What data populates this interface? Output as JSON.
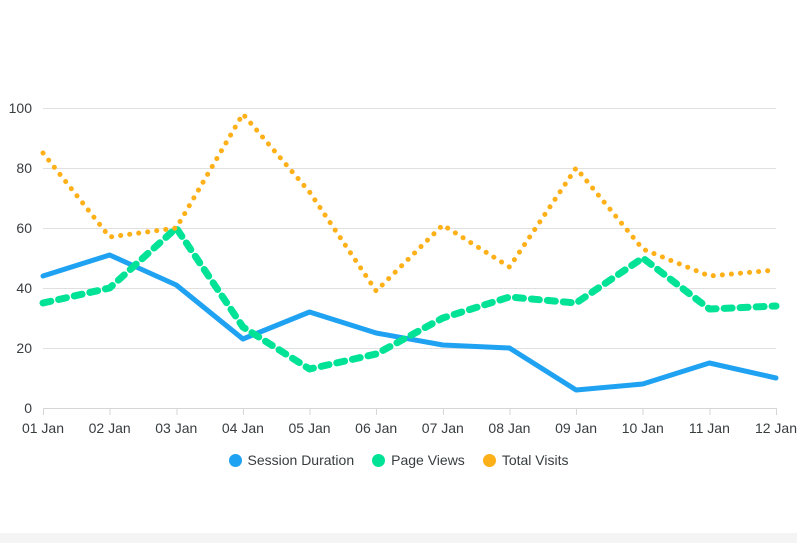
{
  "chart_data": {
    "type": "line",
    "title": "",
    "subtitle": "",
    "xlabel": "",
    "ylabel": "",
    "categories": [
      "01 Jan",
      "02 Jan",
      "03 Jan",
      "04 Jan",
      "05 Jan",
      "06 Jan",
      "07 Jan",
      "08 Jan",
      "09 Jan",
      "10 Jan",
      "11 Jan",
      "12 Jan"
    ],
    "yticks": [
      0,
      20,
      40,
      60,
      80,
      100
    ],
    "ylim": [
      0,
      100
    ],
    "grid": true,
    "legend_position": "bottom",
    "series": [
      {
        "name": "Session Duration",
        "color": "#1FA2F1",
        "style": "solid",
        "width": 5,
        "values": [
          44,
          51,
          41,
          23,
          32,
          25,
          21,
          20,
          6,
          8,
          15,
          10
        ]
      },
      {
        "name": "Page Views",
        "color": "#00E396",
        "style": "dashed",
        "width": 7,
        "values": [
          35,
          40,
          60,
          27,
          13,
          18,
          30,
          37,
          35,
          50,
          33,
          34
        ]
      },
      {
        "name": "Total Visits",
        "color": "#FEB019",
        "style": "dotted",
        "width": 5,
        "values": [
          85,
          57,
          60,
          98,
          72,
          39,
          61,
          47,
          80,
          53,
          44,
          46
        ]
      }
    ]
  },
  "legend": {
    "items": [
      {
        "label": "Session Duration",
        "color": "#1FA2F1"
      },
      {
        "label": "Page Views",
        "color": "#00E396"
      },
      {
        "label": "Total Visits",
        "color": "#FEB019"
      }
    ]
  },
  "axes": {
    "y_tick_labels": [
      "100",
      "80",
      "60",
      "40",
      "20",
      "0"
    ],
    "x_tick_labels": [
      "01 Jan",
      "02 Jan",
      "03 Jan",
      "04 Jan",
      "05 Jan",
      "06 Jan",
      "07 Jan",
      "08 Jan",
      "09 Jan",
      "10 Jan",
      "11 Jan",
      "12 Jan"
    ]
  },
  "colors": {
    "background": "#ffffff",
    "grid": "#e0e0e0",
    "axis": "#d6d6d6",
    "text": "#373d3f",
    "bottom_strip": "#f4f4f4"
  }
}
